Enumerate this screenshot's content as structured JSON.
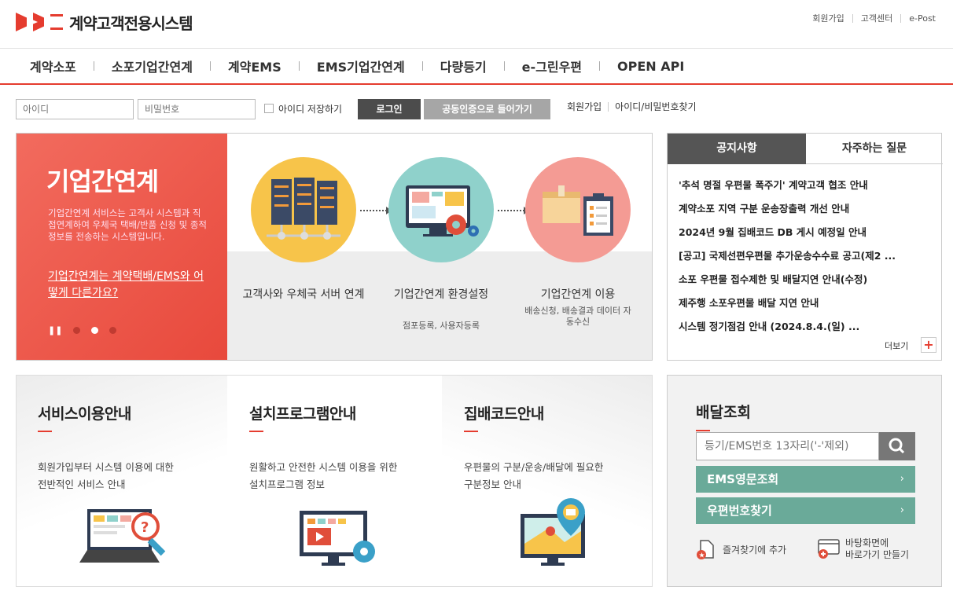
{
  "header": {
    "logo_text": "계약고객전용시스템",
    "top_links": [
      "회원가입",
      "고객센터",
      "e-Post"
    ]
  },
  "gnb": [
    "계약소포",
    "소포기업간연계",
    "계약EMS",
    "EMS기업간연계",
    "다량등기",
    "e-그린우편",
    "OPEN API"
  ],
  "login": {
    "id_placeholder": "아이디",
    "pw_placeholder": "비밀번호",
    "save_id_label": "아이디 저장하기",
    "login_button": "로그인",
    "cert_button": "공동인증으로 들어가기",
    "links": [
      "회원가입",
      "아이디/비밀번호찾기"
    ]
  },
  "banner": {
    "title": "기업간연계",
    "description": "기업간연계 서비스는 고객사 시스템과 직접연계하여 우체국 택배/반품 신청 및 종적정보를 전송하는 시스템입니다.",
    "link_text": "기업간연계는 계약택배/EMS와 어떻게 다른가요?",
    "pause_glyph": "❚❚",
    "steps": [
      {
        "label": "고객사와 우체국 서버 연계",
        "sub": ""
      },
      {
        "label": "기업간연계 환경설정",
        "sub": "점포등록, 사용자등록"
      },
      {
        "label": "기업간연계 이용",
        "sub": "배송신청, 배송결과 데이터 자동수신"
      }
    ],
    "colors": {
      "red": "#ef5a4c",
      "yellow": "#f7c44a",
      "teal": "#8fd1cb",
      "pink": "#f49b94"
    }
  },
  "notice": {
    "tab_notice": "공지사항",
    "tab_faq": "자주하는 질문",
    "items": [
      "'추석 명절 우편물 폭주기' 계약고객 협조 안내",
      "계약소포 지역 구분 운송장출력 개선 안내",
      "2024년 9월 집배코드 DB 게시 예정일 안내",
      "[공고] 국제선편우편물 추가운송수수료 공고(제2 ...",
      "소포 우편물 접수제한 및 배달지연 안내(수정)",
      "제주행 소포우편물 배달 지연 안내",
      "시스템 정기점검 안내 (2024.8.4.(일)  ..."
    ],
    "more_label": "더보기",
    "more_glyph": "+"
  },
  "cards": [
    {
      "title": "서비스이용안내",
      "desc1": "회원가입부터 시스템 이용에 대한",
      "desc2": "전반적인 서비스 안내"
    },
    {
      "title": "설치프로그램안내",
      "desc1": "원활하고 안전한 시스템 이용을 위한",
      "desc2": "설치프로그램 정보"
    },
    {
      "title": "집배코드안내",
      "desc1": "우편물의 구분/운송/배달에 필요한",
      "desc2": "구분정보 안내"
    }
  ],
  "delivery": {
    "title": "배달조회",
    "input_placeholder": "등기/EMS번호 13자리('-'제외)",
    "ems_button": "EMS영문조회",
    "zip_button": "우편번호찾기",
    "chevron": "›",
    "bookmark_label": "즐겨찾기에 추가",
    "shortcut_line1": "바탕화면에",
    "shortcut_line2": "바로가기 만들기"
  }
}
